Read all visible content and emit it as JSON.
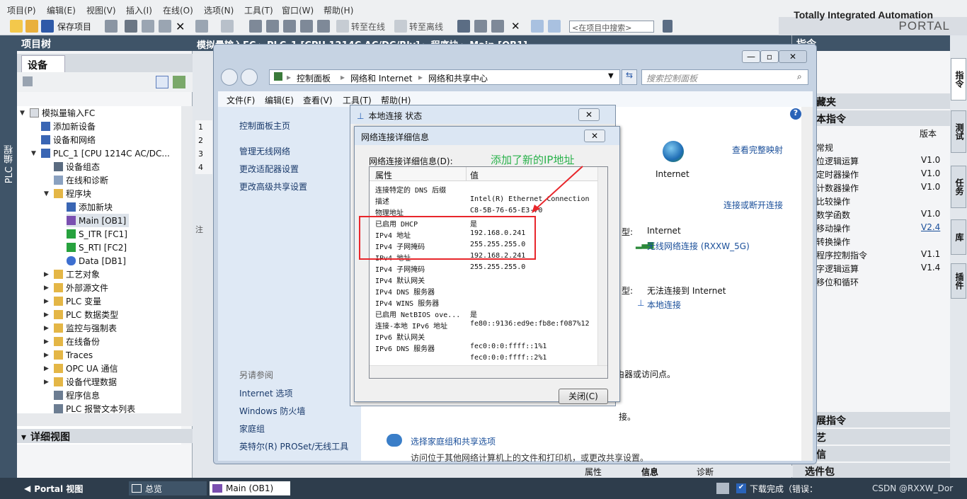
{
  "menu": [
    "项目(P)",
    "编辑(E)",
    "视图(V)",
    "插入(I)",
    "在线(O)",
    "选项(N)",
    "工具(T)",
    "窗口(W)",
    "帮助(H)"
  ],
  "toolbar": {
    "save": "保存项目",
    "go_online": "转至在线",
    "go_offline": "转至离线",
    "search_placeholder": "<在项目中搜索>"
  },
  "brand": {
    "line1": "Totally Integrated Automation",
    "line2": "PORTAL"
  },
  "left_strip": "PLC 编程",
  "project_tree": {
    "title": "项目树",
    "tab": "设备",
    "items": [
      "模拟量输入FC",
      "添加新设备",
      "设备和网络",
      "PLC_1 [CPU 1214C AC/DC...",
      "设备组态",
      "在线和诊断",
      "程序块",
      "添加新块",
      "Main [OB1]",
      "S_ITR [FC1]",
      "S_RTI [FC2]",
      "Data [DB1]",
      "工艺对象",
      "外部源文件",
      "PLC 变量",
      "PLC 数据类型",
      "监控与强制表",
      "在线备份",
      "Traces",
      "OPC UA 通信",
      "设备代理数据",
      "程序信息",
      "PLC 报警文本列表"
    ],
    "detail": "详细视图"
  },
  "editor": {
    "title": "模拟量输入FC ▸ PLC_1 [CPU 1214C AC/DC/Rly] ▸ 程序块 ▸ Main [OB1]",
    "row_nums": [
      "1",
      "2",
      "3",
      "4"
    ],
    "note": "注"
  },
  "control_panel": {
    "breadcrumb": [
      "控制面板",
      "网络和 Internet",
      "网络和共享中心"
    ],
    "search_placeholder": "搜索控制面板",
    "menu": [
      "文件(F)",
      "编辑(E)",
      "查看(V)",
      "工具(T)",
      "帮助(H)"
    ],
    "left_links": [
      "控制面板主页",
      "管理无线网络",
      "更改适配器设置",
      "更改高级共享设置"
    ],
    "see_also_title": "另请参阅",
    "see_also": [
      "Internet 选项",
      "Windows 防火墙",
      "家庭组",
      "英特尔(R) PROSet/无线工具"
    ],
    "main": {
      "view_full_map": "查看完整映射",
      "internet": "Internet",
      "connect_disconnect": "连接或断开连接",
      "access_type_label1": "型:",
      "access_type1": "Internet",
      "conn1_label": "无线网络连接 (RXXW_5G)",
      "access_type_label2": "型:",
      "access_type2": "无法连接到 Internet",
      "conn2_label": "本地连接",
      "text_a": "由器或访问点。",
      "text_b": "接。",
      "homegroup_link": "选择家庭组和共享选项",
      "homegroup_desc": "访问位于其他网络计算机上的文件和打印机，或更改共享设置。"
    }
  },
  "status_dialog": {
    "title": "本地连接 状态"
  },
  "details_dialog": {
    "title": "网络连接详细信息",
    "label": "网络连接详细信息(D):",
    "annotation": "添加了新的IP地址",
    "col_prop": "属性",
    "col_val": "值",
    "rows": [
      [
        "连接特定的 DNS 后缀",
        ""
      ],
      [
        "描述",
        "Intel(R) Ethernet Connection"
      ],
      [
        "物理地址",
        "C8-5B-76-65-E3-70"
      ],
      [
        "已启用 DHCP",
        "是"
      ],
      [
        "IPv4 地址",
        "192.168.0.241"
      ],
      [
        "IPv4 子网掩码",
        "255.255.255.0"
      ],
      [
        "IPv4 地址",
        "192.168.2.241"
      ],
      [
        "IPv4 子网掩码",
        "255.255.255.0"
      ],
      [
        "IPv4 默认网关",
        ""
      ],
      [
        "IPv4 DNS 服务器",
        ""
      ],
      [
        "IPv4 WINS 服务器",
        ""
      ],
      [
        "已启用 NetBIOS ove...",
        "是"
      ],
      [
        "连接-本地 IPv6 地址",
        "fe80::9136:ed9e:fb8e:f087%12"
      ],
      [
        "IPv6 默认网关",
        ""
      ],
      [
        "IPv6 DNS 服务器",
        "fec0:0:0:ffff::1%1"
      ],
      [
        "",
        "fec0:0:0:ffff::2%1"
      ]
    ],
    "close": "关闭(C)"
  },
  "instructions": {
    "title": "指令",
    "section1": "藏夹",
    "section2": "本指令",
    "col_version": "版本",
    "items": [
      [
        "常规",
        ""
      ],
      [
        "位逻辑运算",
        "V1.0"
      ],
      [
        "定时器操作",
        "V1.0"
      ],
      [
        "计数器操作",
        "V1.0"
      ],
      [
        "比较操作",
        ""
      ],
      [
        "数学函数",
        "V1.0"
      ],
      [
        "移动操作",
        "V2.4"
      ],
      [
        "转换操作",
        ""
      ],
      [
        "程序控制指令",
        "V1.1"
      ],
      [
        "字逻辑运算",
        "V1.4"
      ],
      [
        "移位和循环",
        ""
      ]
    ],
    "bottom": [
      "展指令",
      "艺",
      "信",
      "选件包"
    ]
  },
  "right_tabs": [
    "指令",
    "测试",
    "任务",
    "库",
    "插件"
  ],
  "bottom_tabs": {
    "props": "属性",
    "info": "信息",
    "diag": "诊断"
  },
  "statusbar": {
    "portal_view": "Portal 视图",
    "overview": "总览",
    "main_tab": "Main (OB1)",
    "download": "下载完成（错误：",
    "watermark": "CSDN @RXXW_Dor"
  }
}
